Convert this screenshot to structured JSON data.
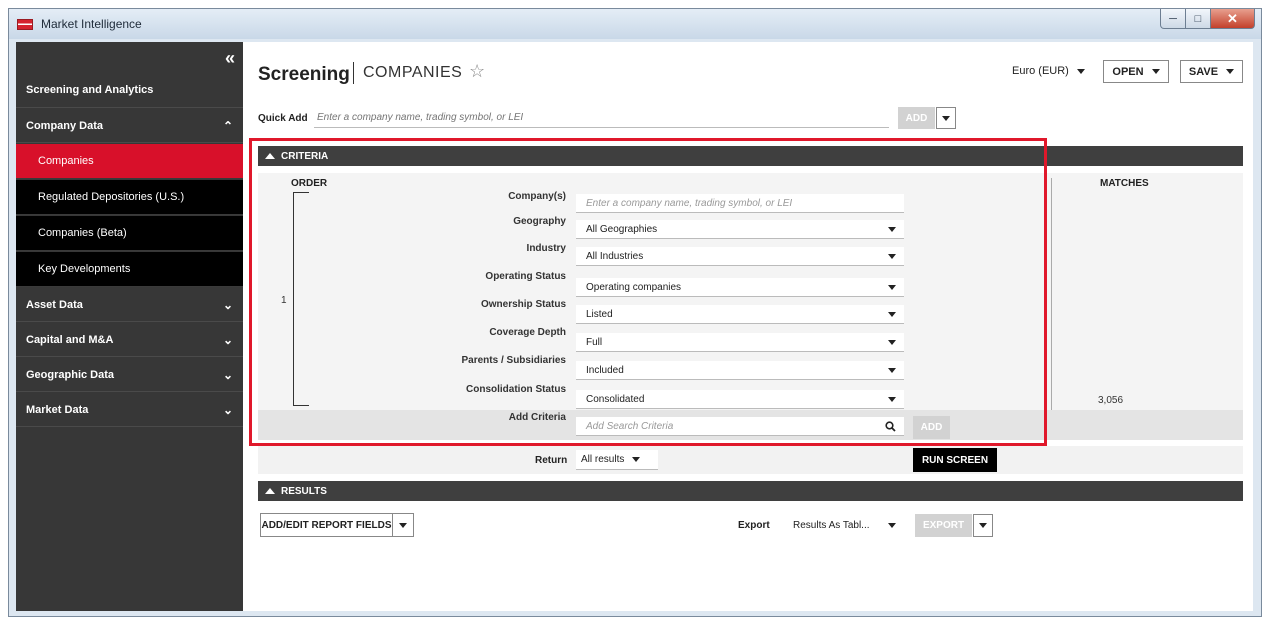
{
  "window": {
    "title": "Market Intelligence",
    "minimize": "─",
    "maximize": "□",
    "close": "✕"
  },
  "sidebar": {
    "collapse_icon": "«",
    "sections": [
      {
        "label": "Screening and Analytics"
      },
      {
        "label": "Company Data",
        "chevron": "^"
      },
      {
        "label": "Asset Data",
        "chevron": "v"
      },
      {
        "label": "Capital and M&A",
        "chevron": "v"
      },
      {
        "label": "Geographic Data",
        "chevron": "v"
      },
      {
        "label": "Market Data",
        "chevron": "v"
      }
    ],
    "company_items": [
      {
        "label": "Companies",
        "active": true
      },
      {
        "label": "Regulated Depositories (U.S.)"
      },
      {
        "label": "Companies (Beta)"
      },
      {
        "label": "Key Developments"
      }
    ]
  },
  "header": {
    "title": "Screening",
    "subtitle": "COMPANIES",
    "favorite_icon": "☆",
    "currency": "Euro (EUR)",
    "open_label": "OPEN",
    "save_label": "SAVE"
  },
  "quick_add": {
    "label": "Quick Add",
    "placeholder": "Enter a company name, trading symbol, or LEI",
    "add_label": "ADD"
  },
  "criteria": {
    "section_label": "CRITERIA",
    "order_label": "ORDER",
    "order_number": "1",
    "matches_label": "MATCHES",
    "matches_value": "3,056",
    "rows": [
      {
        "label": "Company(s)",
        "placeholder": "Enter a company name, trading symbol, or LEI"
      },
      {
        "label": "Geography",
        "value": "All Geographies"
      },
      {
        "label": "Industry",
        "value": "All Industries"
      },
      {
        "label": "Operating Status",
        "value": "Operating companies"
      },
      {
        "label": "Ownership Status",
        "value": "Listed"
      },
      {
        "label": "Coverage Depth",
        "value": "Full"
      },
      {
        "label": "Parents / Subsidiaries",
        "value": "Included"
      },
      {
        "label": "Consolidation Status",
        "value": "Consolidated"
      }
    ],
    "add_criteria_label": "Add Criteria",
    "add_criteria_placeholder": "Add Search Criteria",
    "add_button": "ADD"
  },
  "run": {
    "return_label": "Return",
    "return_value": "All results",
    "run_button": "RUN SCREEN"
  },
  "results": {
    "section_label": "RESULTS",
    "add_edit_fields": "ADD/EDIT REPORT FIELDS",
    "export_label": "Export",
    "export_format": "Results As Tabl...",
    "export_button": "EXPORT"
  }
}
